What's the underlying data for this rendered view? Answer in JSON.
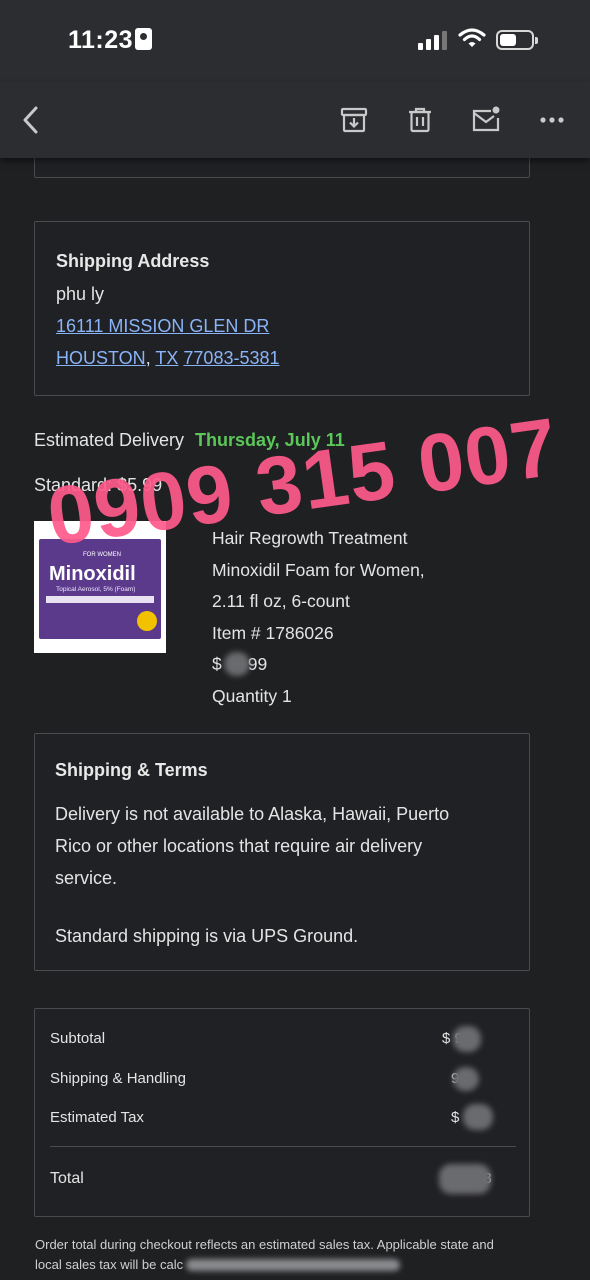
{
  "status_bar": {
    "time": "11:23"
  },
  "toolbar": {
    "icons": [
      "back-arrow-icon",
      "archive-icon",
      "trash-icon",
      "mark-unread-icon",
      "more-icon"
    ]
  },
  "shipping_address": {
    "heading": "Shipping Address",
    "name": "phu ly",
    "street": "16111 MISSION GLEN DR",
    "city": "HOUSTON",
    "separator": ", ",
    "state": "TX",
    "zip": "77083-5381"
  },
  "delivery": {
    "label": "Estimated Delivery",
    "date": "Thursday, July 11",
    "method": "Standard: $5.99"
  },
  "watermark": "0909 315 007",
  "item": {
    "image_brand": "Minoxidil",
    "image_tag": "FOR WOMEN",
    "image_subtitle": "Topical Aerosol, 5% (Foam)",
    "name_line1": "Hair Regrowth Treatment",
    "name_line2": "Minoxidil Foam for Women,",
    "name_line3": "2.11 fl oz, 6-count",
    "item_number": "Item # 1786026",
    "price_prefix": "$",
    "price_suffix": "99",
    "quantity": "Quantity 1"
  },
  "terms": {
    "heading": "Shipping & Terms",
    "line1": "Delivery is not available to Alaska, Hawaii, Puerto",
    "line2": "Rico or other locations that require air delivery",
    "line3": "service.",
    "line4": "Standard shipping is via UPS Ground."
  },
  "summary": {
    "subtotal_label": "Subtotal",
    "subtotal_value": "$ 99",
    "shipping_label": "Shipping & Handling",
    "shipping_value": "99",
    "tax_label": "Estimated Tax",
    "tax_value": "$",
    "total_label": "Total",
    "total_value": "28"
  },
  "footer": {
    "line1": "Order total during checkout reflects an estimated sales tax. Applicable state and",
    "line2": "local sales tax will be calc"
  },
  "colors": {
    "background": "#1f2022",
    "delivery_date": "#5cc65a",
    "link": "#8ab4f8",
    "watermark": "#ff5a8c"
  }
}
